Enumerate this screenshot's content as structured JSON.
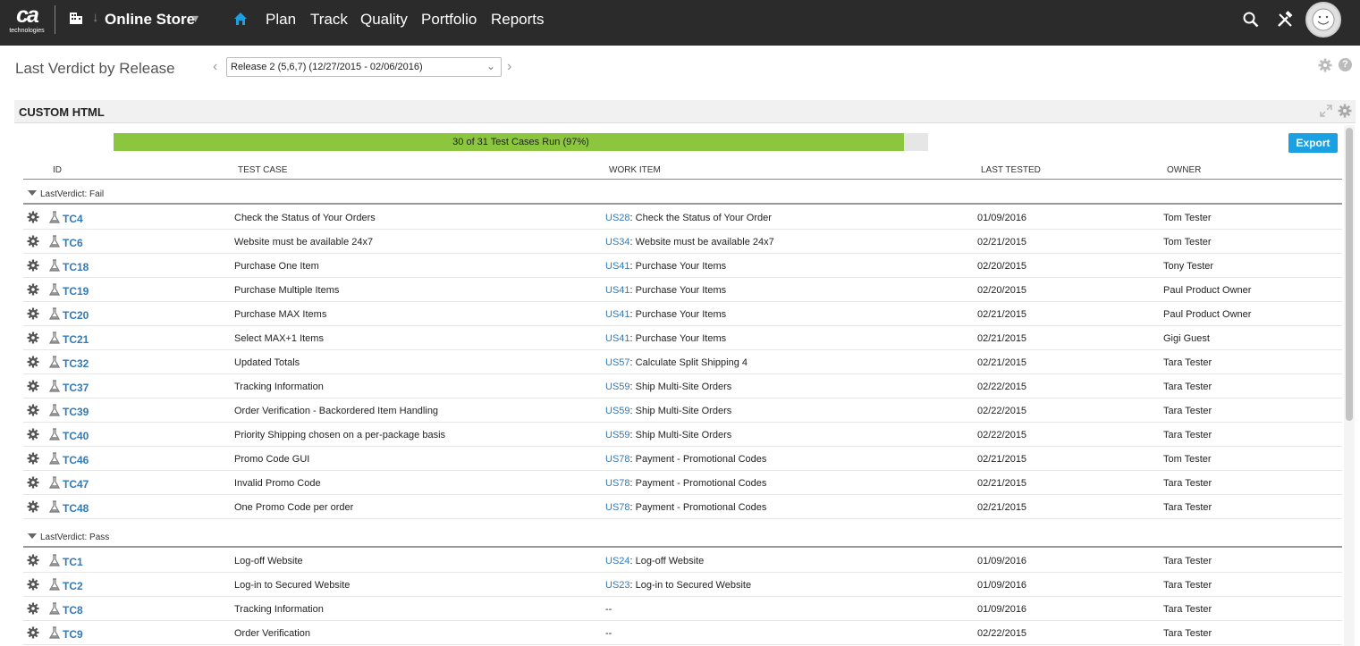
{
  "nav": {
    "logo_main": "ca",
    "logo_sub": "technologies",
    "project": "Online Store",
    "links": [
      "Plan",
      "Track",
      "Quality",
      "Portfolio",
      "Reports"
    ]
  },
  "page": {
    "title": "Last Verdict by Release",
    "release_value": "Release 2 (5,6,7) (12/27/2015 - 02/06/2016)",
    "help_glyph": "?"
  },
  "panel": {
    "title": "CUSTOM HTML",
    "progress_label": "30 of 31 Test Cases Run (97%)",
    "progress_fraction": 0.97,
    "export_label": "Export"
  },
  "columns": {
    "id": "ID",
    "test_case": "TEST CASE",
    "work_item": "WORK ITEM",
    "last_tested": "LAST TESTED",
    "owner": "OWNER"
  },
  "groups": [
    {
      "label": "LastVerdict: Fail",
      "rows": [
        {
          "id": "TC4",
          "name": "Check the Status of Your Orders",
          "wi_id": "US28",
          "wi_name": ": Check the Status of Your Order",
          "last_tested": "01/09/2016",
          "owner": "Tom Tester"
        },
        {
          "id": "TC6",
          "name": "Website must be available 24x7",
          "wi_id": "US34",
          "wi_name": ": Website must be available 24x7",
          "last_tested": "02/21/2015",
          "owner": "Tom Tester"
        },
        {
          "id": "TC18",
          "name": "Purchase One Item",
          "wi_id": "US41",
          "wi_name": ": Purchase Your Items",
          "last_tested": "02/20/2015",
          "owner": "Tony Tester"
        },
        {
          "id": "TC19",
          "name": "Purchase Multiple Items",
          "wi_id": "US41",
          "wi_name": ": Purchase Your Items",
          "last_tested": "02/20/2015",
          "owner": "Paul Product Owner"
        },
        {
          "id": "TC20",
          "name": "Purchase MAX Items",
          "wi_id": "US41",
          "wi_name": ": Purchase Your Items",
          "last_tested": "02/21/2015",
          "owner": "Paul Product Owner"
        },
        {
          "id": "TC21",
          "name": "Select MAX+1 Items",
          "wi_id": "US41",
          "wi_name": ": Purchase Your Items",
          "last_tested": "02/21/2015",
          "owner": "Gigi Guest"
        },
        {
          "id": "TC32",
          "name": "Updated Totals",
          "wi_id": "US57",
          "wi_name": ": Calculate Split Shipping 4",
          "last_tested": "02/21/2015",
          "owner": "Tara Tester"
        },
        {
          "id": "TC37",
          "name": "Tracking Information",
          "wi_id": "US59",
          "wi_name": ": Ship Multi-Site Orders",
          "last_tested": "02/22/2015",
          "owner": "Tara Tester"
        },
        {
          "id": "TC39",
          "name": "Order Verification - Backordered Item Handling",
          "wi_id": "US59",
          "wi_name": ": Ship Multi-Site Orders",
          "last_tested": "02/22/2015",
          "owner": "Tara Tester"
        },
        {
          "id": "TC40",
          "name": "Priority Shipping chosen on a per-package basis",
          "wi_id": "US59",
          "wi_name": ": Ship Multi-Site Orders",
          "last_tested": "02/22/2015",
          "owner": "Tara Tester"
        },
        {
          "id": "TC46",
          "name": "Promo Code GUI",
          "wi_id": "US78",
          "wi_name": ": Payment - Promotional Codes",
          "last_tested": "02/21/2015",
          "owner": "Tom Tester"
        },
        {
          "id": "TC47",
          "name": "Invalid Promo Code",
          "wi_id": "US78",
          "wi_name": ": Payment - Promotional Codes",
          "last_tested": "02/21/2015",
          "owner": "Tara Tester"
        },
        {
          "id": "TC48",
          "name": "One Promo Code per order",
          "wi_id": "US78",
          "wi_name": ": Payment - Promotional Codes",
          "last_tested": "02/21/2015",
          "owner": "Tara Tester"
        }
      ]
    },
    {
      "label": "LastVerdict: Pass",
      "rows": [
        {
          "id": "TC1",
          "name": "Log-off Website",
          "wi_id": "US24",
          "wi_name": ": Log-off Website",
          "last_tested": "01/09/2016",
          "owner": "Tara Tester"
        },
        {
          "id": "TC2",
          "name": "Log-in to Secured Website",
          "wi_id": "US23",
          "wi_name": ": Log-in to Secured Website",
          "last_tested": "01/09/2016",
          "owner": "Tara Tester"
        },
        {
          "id": "TC8",
          "name": "Tracking Information",
          "wi_id": "",
          "wi_name": "--",
          "last_tested": "01/09/2016",
          "owner": "Tara Tester"
        },
        {
          "id": "TC9",
          "name": "Order Verification",
          "wi_id": "",
          "wi_name": "--",
          "last_tested": "02/22/2015",
          "owner": "Tara Tester"
        }
      ]
    }
  ]
}
